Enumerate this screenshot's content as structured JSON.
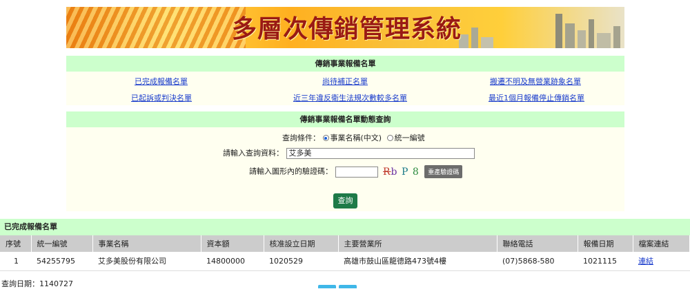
{
  "banner": {
    "title": "多層次傳銷管理系統"
  },
  "registry_panel": {
    "title": "傳銷事業報備名單",
    "links": [
      "已完成報備名單",
      "尚待補正名單",
      "搬遷不明及無營業跡象名單",
      "已起訴或判決名單",
      "近三年違反衛生法規次數較多名單",
      "最近1個月報備停止傳銷名單"
    ]
  },
  "query_panel": {
    "title": "傳銷事業報備名單動態查詢",
    "condition_label": "查詢條件：",
    "option_name": "事業名稱(中文)",
    "option_id": "統一編號",
    "input_label": "請輸入查詢資料：",
    "input_value": "艾多美",
    "captcha_label": "請輸入圖形內的驗證碼：",
    "captcha_value": "",
    "captcha_text": "Rb P 8",
    "refresh_label": "重產驗證碼",
    "submit_label": "查詢"
  },
  "results": {
    "title": "已完成報備名單",
    "columns": [
      "序號",
      "統一編號",
      "事業名稱",
      "資本額",
      "核准設立日期",
      "主要營業所",
      "聯絡電話",
      "報備日期",
      "檔案連結"
    ],
    "rows": [
      [
        "1",
        "54255795",
        "艾多美股份有限公司",
        "14800000",
        "1020529",
        "高雄市鼓山區龍德路473號4樓",
        "(07)5868-580",
        "1021115",
        "連結"
      ]
    ]
  },
  "footer": {
    "query_date": "查詢日期：1140727"
  },
  "colors": {
    "panel_header": "#ccffcc",
    "panel_body": "#fffff0",
    "link": "#1a3ccc",
    "submit": "#1e7a48"
  }
}
